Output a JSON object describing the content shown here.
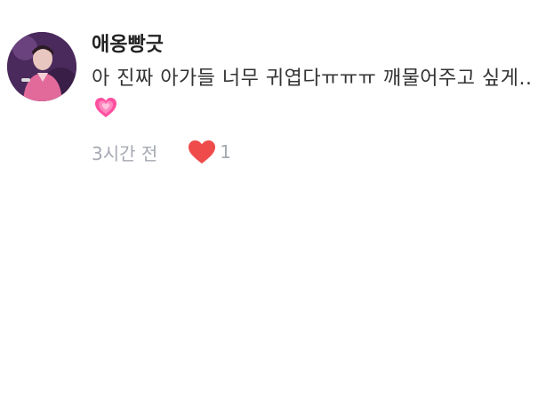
{
  "comment": {
    "username": "애옹빵긋",
    "text": "아 진짜 아가들 너무 귀엽다ㅠㅠㅠ 깨물어주고 싶게..",
    "text_emoji": "growing-heart-icon",
    "time": "3시간 전",
    "like_count": "1",
    "like_icon": "heart-icon",
    "colors": {
      "heart": "#ef4b4b",
      "emoji_heart": "#ff5fa8",
      "meta": "#a6a9b2",
      "username": "#222222"
    }
  }
}
